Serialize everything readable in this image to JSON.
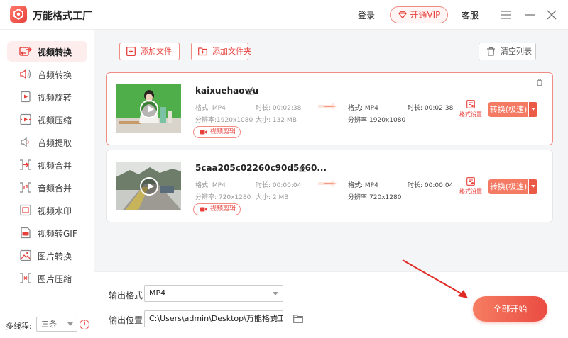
{
  "app": {
    "title": "万能格式工厂",
    "login": "登录",
    "vip": "开通VIP",
    "service": "客服"
  },
  "sidebar": {
    "items": [
      {
        "label": "视频转换",
        "icon": "video-convert-icon"
      },
      {
        "label": "音频转换",
        "icon": "audio-convert-icon"
      },
      {
        "label": "视频旋转",
        "icon": "video-rotate-icon"
      },
      {
        "label": "视频压缩",
        "icon": "video-compress-icon"
      },
      {
        "label": "音频提取",
        "icon": "audio-extract-icon"
      },
      {
        "label": "视频合并",
        "icon": "video-merge-icon"
      },
      {
        "label": "音频合并",
        "icon": "audio-merge-icon"
      },
      {
        "label": "视频水印",
        "icon": "video-watermark-icon"
      },
      {
        "label": "视频转GIF",
        "icon": "video-gif-icon"
      },
      {
        "label": "图片转换",
        "icon": "image-convert-icon"
      },
      {
        "label": "图片压缩",
        "icon": "image-compress-icon"
      }
    ],
    "threads_label": "多线程:",
    "threads_value": "三条",
    "info": "i"
  },
  "toolbar": {
    "add_file": "添加文件",
    "add_folder": "添加文件夹",
    "clear_list": "清空列表"
  },
  "files": [
    {
      "name": "kaixuehaowu",
      "src_format": "格式: MP4",
      "src_duration": "时长: 00:02:38",
      "src_resolution": "分辨率:1920x1080",
      "src_size": "大小: 132 MB",
      "out_format": "格式: MP4",
      "out_duration": "时长: 00:02:38",
      "out_resolution": "分辨率:1920x1080",
      "clip": "视频剪辑",
      "format_settings": "格式设置",
      "convert": "转换(极速)"
    },
    {
      "name": "5caa205c02260c90d5460...",
      "src_format": "格式: MP4",
      "src_duration": "时长: 00:00:04",
      "src_resolution": "分辨率: 720x1280",
      "src_size": "大小: 2 MB",
      "out_format": "格式: MP4",
      "out_duration": "时长: 00:00:04",
      "out_resolution": "分辨率:720x1280",
      "clip": "视频剪辑",
      "format_settings": "格式设置",
      "convert": "转换(极速)"
    }
  ],
  "output": {
    "format_label": "输出格式",
    "format_value": "MP4",
    "path_label": "输出位置",
    "path_value": "C:\\Users\\admin\\Desktop\\万能格式工厂",
    "start_all": "全部开始"
  },
  "colors": {
    "accent": "#e8413c",
    "accent_light": "#f47a64"
  }
}
